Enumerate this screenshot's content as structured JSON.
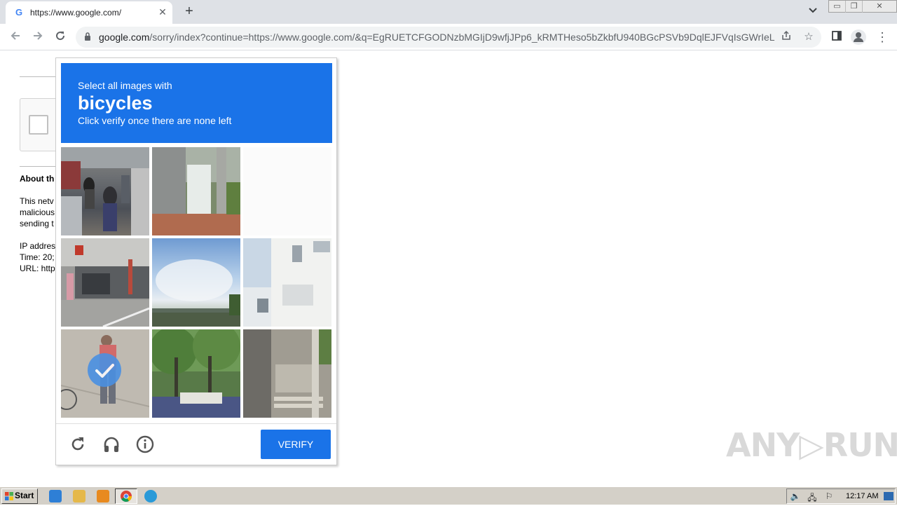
{
  "browser": {
    "tab_title": "https://www.google.com/",
    "tab_favicon": "G",
    "close_glyph": "✕",
    "newtab_glyph": "+",
    "url_host": "google.com",
    "url_path": "/sorry/index?continue=https://www.google.com/&q=EgRUETCFGODNzbMGIjD9wfjJPp6_kRMTHeso5bZkbfU940BGcPSVb9DqlEJFVqIsGWrIeLui..."
  },
  "page": {
    "about_heading": "About th",
    "line1": "This netv",
    "line2": "malicious",
    "line3": "sending t",
    "ip": "IP addres",
    "time": "Time: 20;",
    "url": "URL: http"
  },
  "captcha": {
    "instruction": "Select all images with",
    "keyword": "bicycles",
    "sub_instruction": "Click verify once there are none left",
    "verify_label": "VERIFY",
    "selected_tile_index": 6,
    "header_color": "#1a73e8",
    "tiles": [
      {
        "name": "street-scooters-tile",
        "selected": false
      },
      {
        "name": "bus-pole-tile",
        "selected": false
      },
      {
        "name": "faded-blank-tile",
        "selected": false
      },
      {
        "name": "shop-front-tile",
        "selected": false
      },
      {
        "name": "sky-bridge-tile",
        "selected": false
      },
      {
        "name": "white-building-tile",
        "selected": false
      },
      {
        "name": "person-sidewalk-tile",
        "selected": true
      },
      {
        "name": "trees-tile",
        "selected": false
      },
      {
        "name": "stairs-pole-tile",
        "selected": false
      }
    ]
  },
  "watermark": "ANY▷RUN",
  "taskbar": {
    "start_label": "Start",
    "clock": "12:17 AM"
  }
}
